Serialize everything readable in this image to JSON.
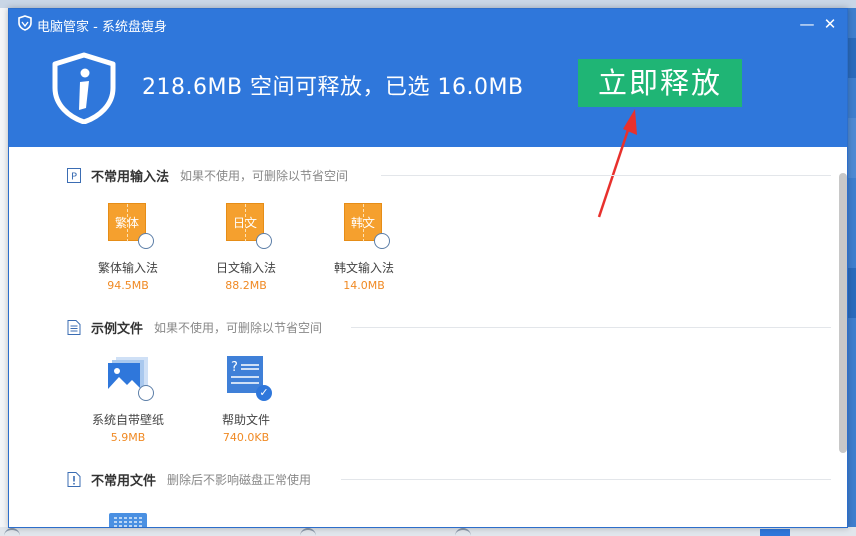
{
  "window": {
    "title": "电脑管家 - 系统盘瘦身",
    "minimize_symbol": "—",
    "close_symbol": "✕"
  },
  "header": {
    "headline": "218.6MB 空间可释放，已选 16.0MB",
    "release_button": "立即释放",
    "accent_color": "#2f77db",
    "button_color": "#1fb575"
  },
  "sections": [
    {
      "title": "不常用输入法",
      "description": "如果不使用，可删除以节省空间",
      "icon": "p-badge-icon",
      "items": [
        {
          "name": "繁体输入法",
          "size": "94.5MB",
          "icon_text": "繁体",
          "checked": false
        },
        {
          "name": "日文输入法",
          "size": "88.2MB",
          "icon_text": "日文",
          "checked": false
        },
        {
          "name": "韩文输入法",
          "size": "14.0MB",
          "icon_text": "韩文",
          "checked": false
        }
      ]
    },
    {
      "title": "示例文件",
      "description": "如果不使用，可删除以节省空间",
      "icon": "document-icon",
      "items": [
        {
          "name": "系统自带壁纸",
          "size": "5.9MB",
          "icon": "wallpaper-icon",
          "checked": false
        },
        {
          "name": "帮助文件",
          "size": "740.0KB",
          "icon": "help-file-icon",
          "checked": true
        }
      ]
    },
    {
      "title": "不常用文件",
      "description": "删除后不影响磁盘正常使用",
      "icon": "alert-file-icon",
      "items": []
    }
  ],
  "checkmark": "✓"
}
